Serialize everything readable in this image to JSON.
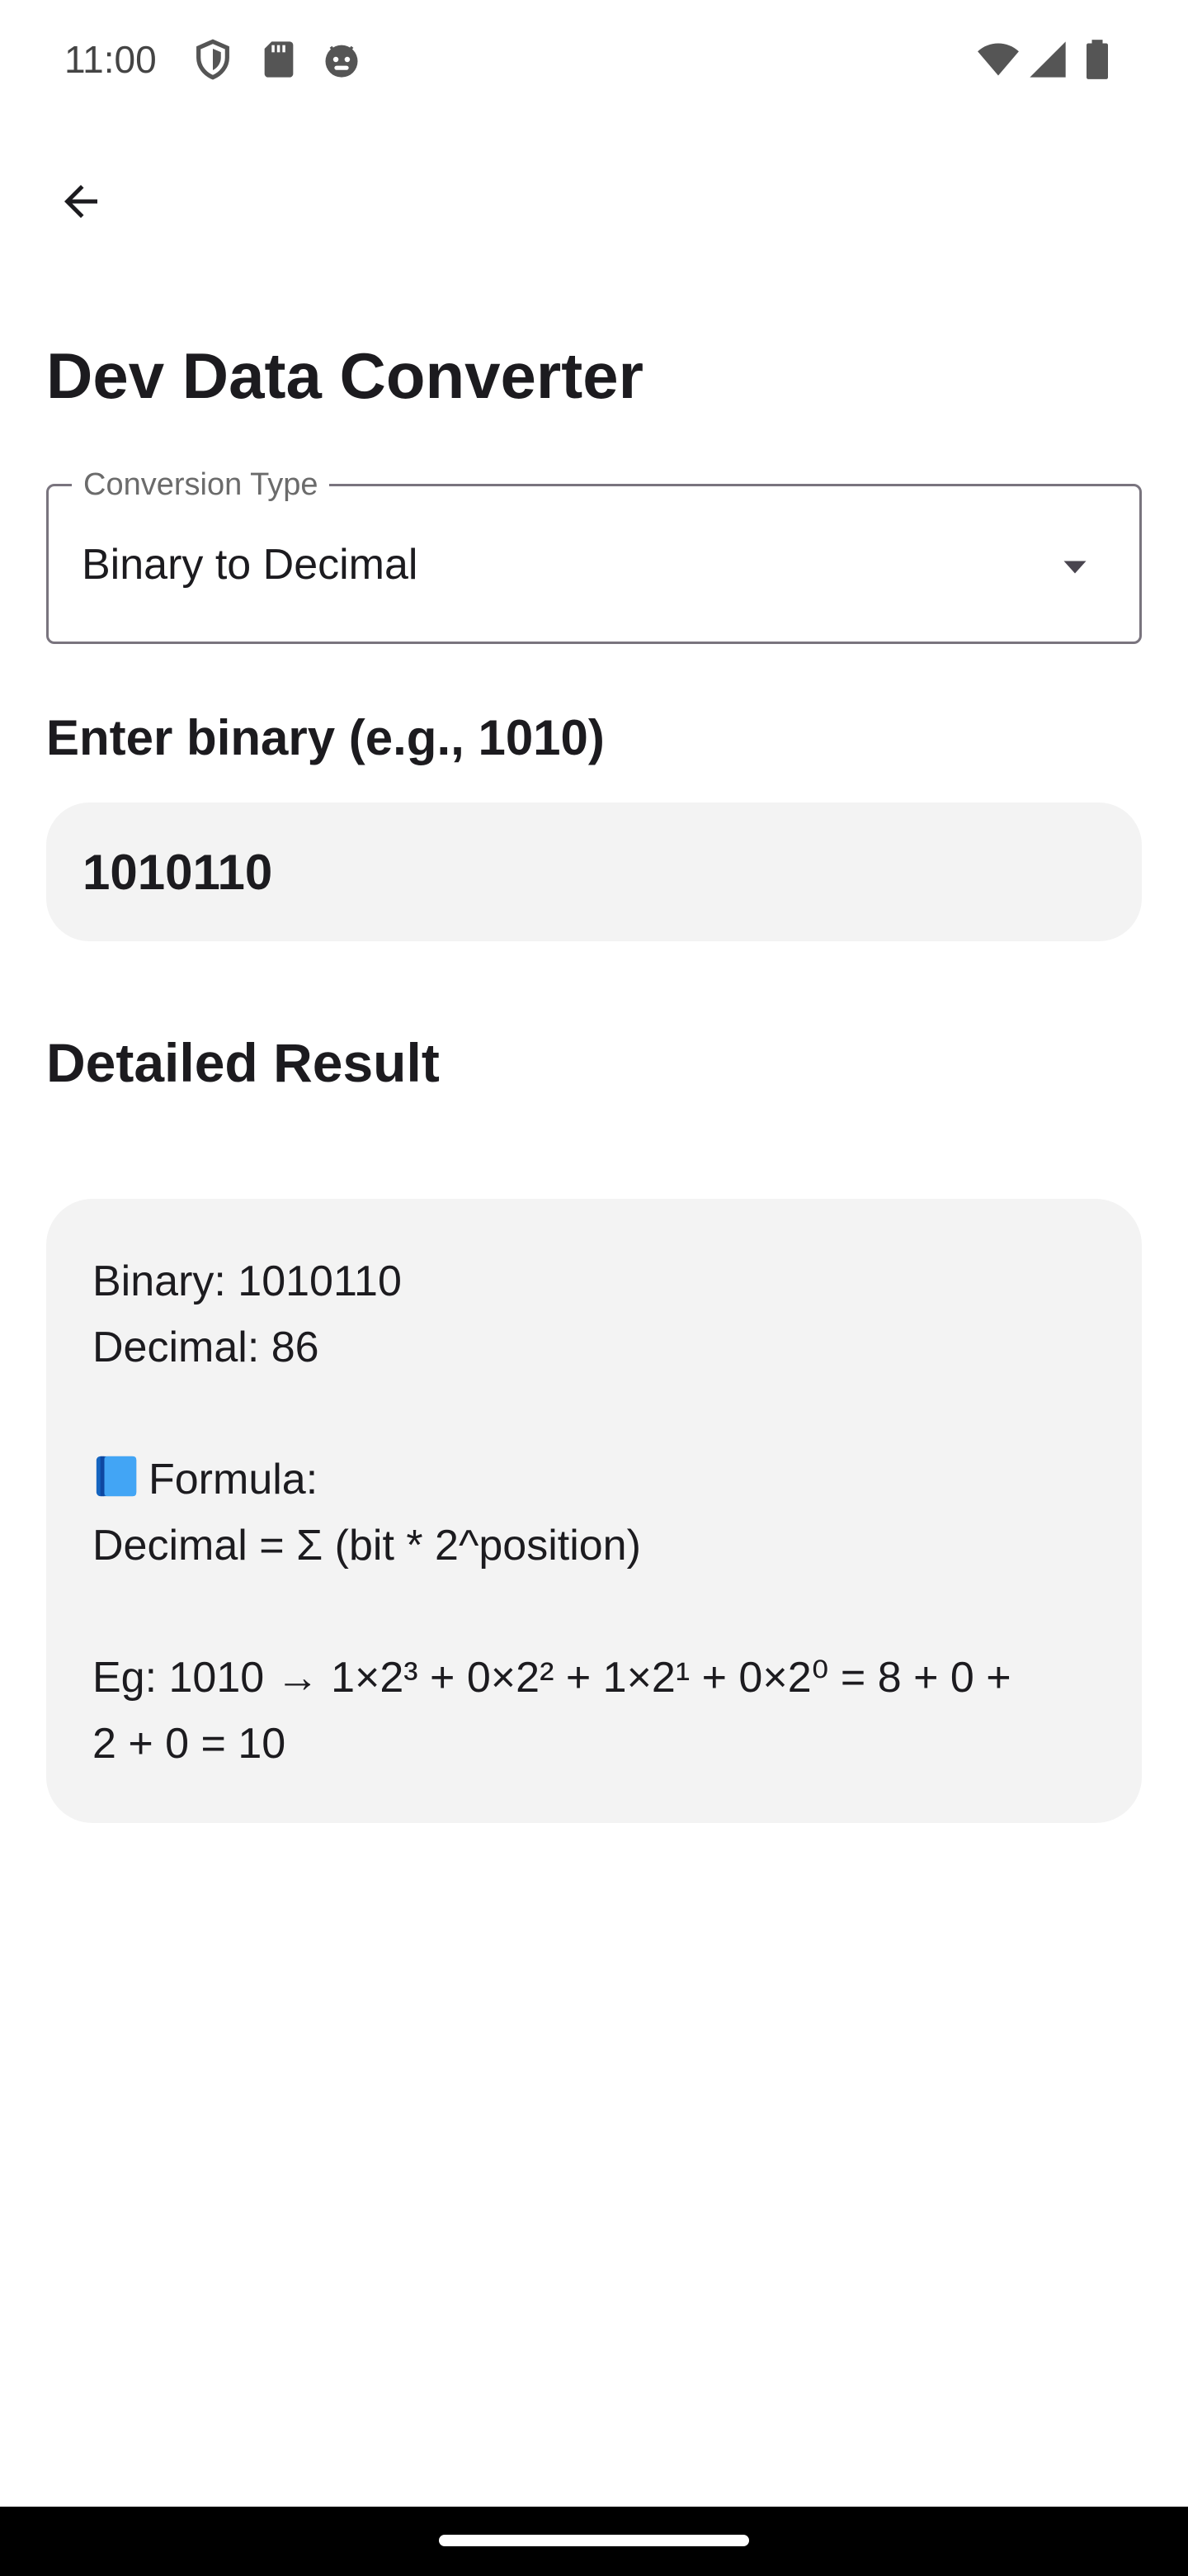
{
  "status_bar": {
    "time": "11:00",
    "left_icons": [
      "shield-icon",
      "sd-card-icon",
      "android-icon"
    ],
    "right_icons": [
      "wifi-icon",
      "cell-signal-icon",
      "battery-icon"
    ]
  },
  "app_bar": {
    "back_icon": "arrow-back-icon"
  },
  "page": {
    "title": "Dev Data Converter"
  },
  "conversion_type": {
    "label": "Conversion Type",
    "selected": "Binary to Decimal"
  },
  "input": {
    "label": "Enter binary (e.g., 1010)",
    "value": "1010110"
  },
  "result": {
    "heading": "Detailed Result",
    "binary_line": "Binary: 1010110",
    "decimal_line": "Decimal: 86",
    "formula_label": "Formula:",
    "formula_icon": "blue-book-icon",
    "formula": "Decimal = Σ (bit * 2^position)",
    "example_line_1": "Eg: 1010 → 1×2³ + 0×2² + 1×2¹ + 0×2⁰ = 8 + 0 +",
    "example_line_2": "2 + 0 = 10"
  },
  "colors": {
    "field_background": "#f3f3f3",
    "outline": "#79747e",
    "text": "#1c1b1f",
    "book_blue": "#1e88e5"
  }
}
